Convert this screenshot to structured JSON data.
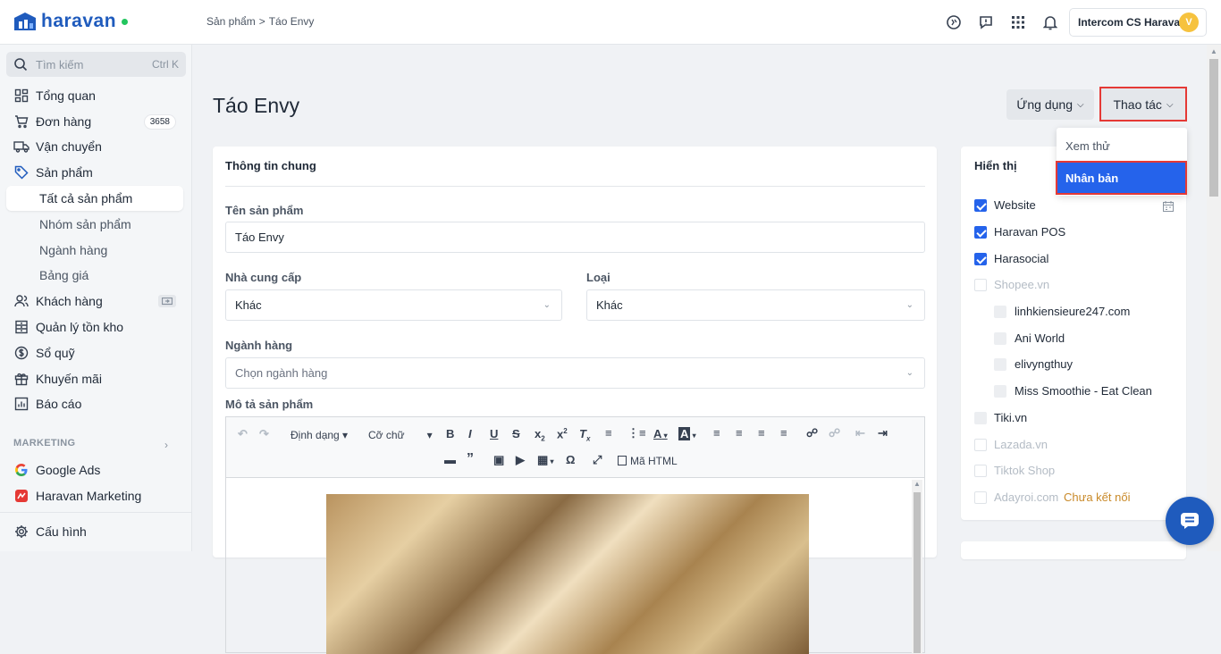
{
  "brand": {
    "name": "haravan"
  },
  "breadcrumb": {
    "parent": "Sản phẩm",
    "separator": ">",
    "current": "Táo Envy"
  },
  "account": {
    "name": "Intercom CS Haravan",
    "initial": "V"
  },
  "search": {
    "placeholder": "Tìm kiếm",
    "shortcut": "Ctrl K"
  },
  "sidebar": {
    "overview": "Tổng quan",
    "orders": "Đơn hàng",
    "orders_count": "3658",
    "shipping": "Vận chuyển",
    "products": "Sản phẩm",
    "all_products": "Tất cả sản phẩm",
    "product_groups": "Nhóm sản phẩm",
    "categories": "Ngành hàng",
    "price_list": "Bảng giá",
    "customers": "Khách hàng",
    "inventory": "Quản lý tồn kho",
    "cashbook": "Sổ quỹ",
    "promotions": "Khuyến mãi",
    "reports": "Báo cáo",
    "marketing_label": "MARKETING",
    "google_ads": "Google Ads",
    "haravan_marketing": "Haravan Marketing",
    "settings": "Cấu hình"
  },
  "page": {
    "title": "Táo Envy",
    "apps_button": "Ứng dụng",
    "actions_button": "Thao tác"
  },
  "actions_menu": {
    "preview": "Xem thử",
    "duplicate": "Nhân bản"
  },
  "general": {
    "heading": "Thông tin chung",
    "name_label": "Tên sản phẩm",
    "name_value": "Táo Envy",
    "vendor_label": "Nhà cung cấp",
    "vendor_value": "Khác",
    "type_label": "Loại",
    "type_value": "Khác",
    "category_label": "Ngành hàng",
    "category_placeholder": "Chọn ngành hàng",
    "description_label": "Mô tả sản phẩm"
  },
  "editor": {
    "format": "Định dạng",
    "font_size": "Cỡ chữ",
    "html": "Mã HTML"
  },
  "visibility": {
    "heading": "Hiển thị",
    "channels": [
      {
        "label": "Website",
        "checked": true
      },
      {
        "label": "Haravan POS",
        "checked": true
      },
      {
        "label": "Harasocial",
        "checked": true
      },
      {
        "label": "Shopee.vn",
        "checked": false
      },
      {
        "label": "linhkiensieure247.com",
        "checked": false
      },
      {
        "label": "Ani World",
        "checked": false
      },
      {
        "label": "elivyngthuy",
        "checked": false
      },
      {
        "label": "Miss Smoothie - Eat Clean",
        "checked": false
      },
      {
        "label": "Tiki.vn",
        "checked": false
      },
      {
        "label": "Lazada.vn",
        "checked": false
      },
      {
        "label": "Tiktok Shop",
        "checked": false
      },
      {
        "label": "Adayroi.com",
        "checked": false
      }
    ],
    "not_connected": "Chưa kết nối"
  },
  "colors": {
    "brand": "#1f5bbd",
    "selected": "#2563eb",
    "highlight": "#e53935"
  }
}
